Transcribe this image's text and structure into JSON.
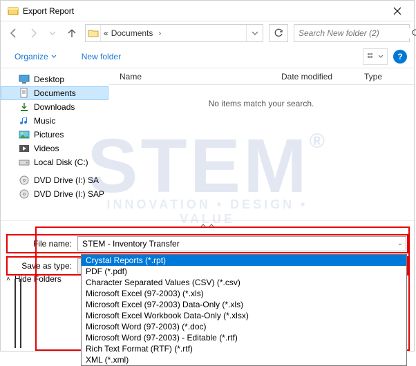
{
  "title": "Export Report",
  "breadcrumb": {
    "prefix": "«",
    "loc": "Documents",
    "sep": "›"
  },
  "search": {
    "placeholder": "Search New folder (2)"
  },
  "toolbar": {
    "organize": "Organize",
    "newfolder": "New folder"
  },
  "columns": {
    "name": "Name",
    "date": "Date modified",
    "type": "Type"
  },
  "empty": "No items match your search.",
  "sidebar": {
    "items": [
      {
        "label": "Desktop",
        "icon": "desktop"
      },
      {
        "label": "Documents",
        "icon": "documents",
        "selected": true
      },
      {
        "label": "Downloads",
        "icon": "downloads"
      },
      {
        "label": "Music",
        "icon": "music"
      },
      {
        "label": "Pictures",
        "icon": "pictures"
      },
      {
        "label": "Videos",
        "icon": "videos"
      },
      {
        "label": "Local Disk (C:)",
        "icon": "disk"
      },
      {
        "label": "DVD Drive (I:) SA",
        "icon": "dvd"
      },
      {
        "label": "DVD Drive (I:) SAP",
        "icon": "dvd"
      }
    ]
  },
  "filename": {
    "label": "File name:",
    "value": "STEM - Inventory Transfer"
  },
  "saveastype": {
    "label": "Save as type:",
    "value": "Crystal Reports (*.rpt)"
  },
  "type_options": [
    "Crystal Reports (*.rpt)",
    "PDF (*.pdf)",
    "Character Separated Values (CSV) (*.csv)",
    "Microsoft Excel (97-2003) (*.xls)",
    "Microsoft Excel (97-2003) Data-Only (*.xls)",
    "Microsoft Excel Workbook Data-Only (*.xlsx)",
    "Microsoft Word (97-2003) (*.doc)",
    "Microsoft Word (97-2003) - Editable (*.rtf)",
    "Rich Text Format (RTF) (*.rtf)",
    "XML (*.xml)"
  ],
  "hidefolders": "Hide Folders",
  "watermark": {
    "text": "STEM",
    "reg": "®",
    "tag": "INNOVATION   •   DESIGN   •   VALUE"
  }
}
